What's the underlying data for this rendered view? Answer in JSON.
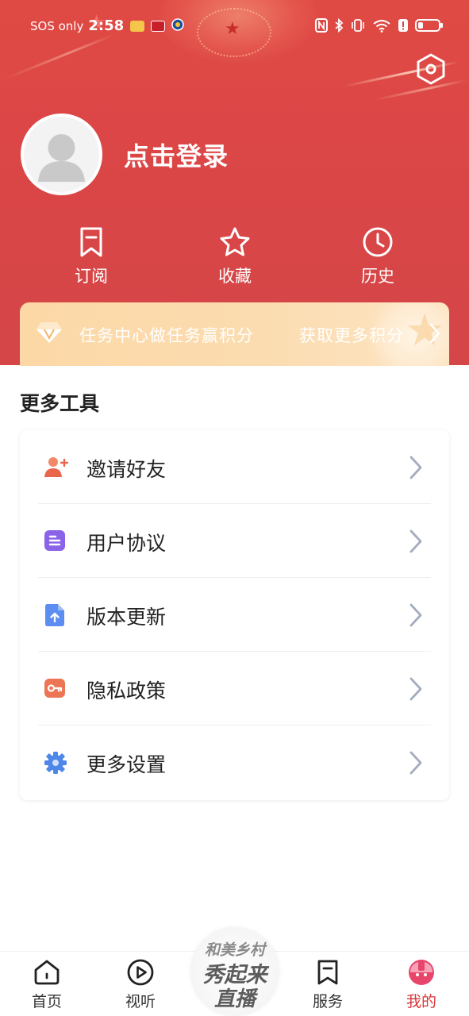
{
  "status_bar": {
    "carrier": "SOS only",
    "time": "2:58"
  },
  "profile": {
    "login_label": "点击登录"
  },
  "quick_actions": [
    {
      "label": "订阅",
      "icon": "bookmark-icon"
    },
    {
      "label": "收藏",
      "icon": "star-icon"
    },
    {
      "label": "历史",
      "icon": "clock-icon"
    }
  ],
  "task_banner": {
    "text": "任务中心做任务赢积分",
    "action": "获取更多积分"
  },
  "tools": {
    "title": "更多工具",
    "items": [
      {
        "label": "邀请好友",
        "icon": "invite-friend-icon"
      },
      {
        "label": "用户协议",
        "icon": "document-icon"
      },
      {
        "label": "版本更新",
        "icon": "update-file-icon"
      },
      {
        "label": "隐私政策",
        "icon": "key-icon"
      },
      {
        "label": "更多设置",
        "icon": "gear-icon"
      }
    ]
  },
  "bottom_nav": {
    "items": [
      {
        "label": "首页",
        "icon": "home-icon"
      },
      {
        "label": "视听",
        "icon": "play-icon"
      },
      {
        "label": "服务",
        "icon": "bookmark-icon"
      },
      {
        "label": "我的",
        "icon": "profile-face-icon",
        "active": true
      }
    ],
    "center_promo": {
      "line1": "和美乡村",
      "line2": "秀起来",
      "line3": "直播"
    }
  },
  "colors": {
    "header_red": "#dc4646",
    "accent_red": "#d8353a",
    "banner_gold": "#fbd9a8"
  }
}
